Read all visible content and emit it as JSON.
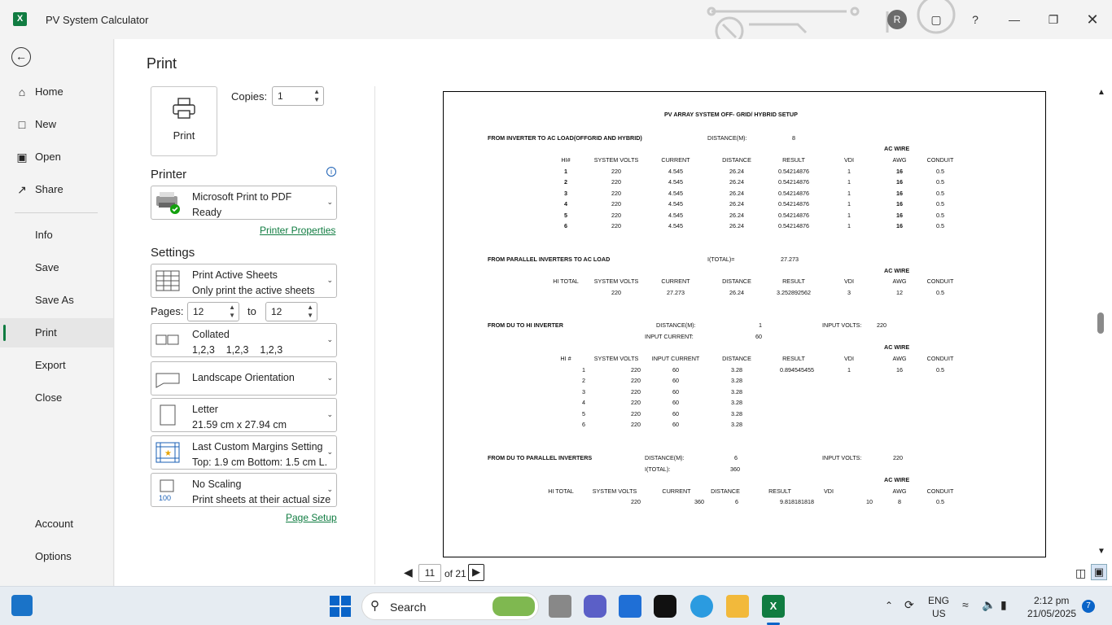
{
  "window": {
    "title": "PV System Calculator",
    "avatar_initial": "R"
  },
  "sidebar": {
    "items": [
      {
        "label": "Home",
        "icon": "home-icon"
      },
      {
        "label": "New",
        "icon": "new-document-icon"
      },
      {
        "label": "Open",
        "icon": "folder-icon"
      },
      {
        "label": "Share",
        "icon": "share-icon"
      },
      {
        "label": "Info"
      },
      {
        "label": "Save"
      },
      {
        "label": "Save As"
      },
      {
        "label": "Print"
      },
      {
        "label": "Export"
      },
      {
        "label": "Close"
      },
      {
        "label": "Account"
      },
      {
        "label": "Options"
      }
    ]
  },
  "print": {
    "title": "Print",
    "print_button": "Print",
    "copies_label": "Copies:",
    "copies_value": "1",
    "printer_heading": "Printer",
    "printer_name": "Microsoft Print to PDF",
    "printer_status": "Ready",
    "printer_properties": "Printer Properties",
    "settings_heading": "Settings",
    "active_sheets": "Print Active Sheets",
    "active_sheets_desc": "Only print the active sheets",
    "pages_label": "Pages:",
    "pages_from": "12",
    "pages_to_label": "to",
    "pages_to": "12",
    "collated": "Collated",
    "collated_desc": "1,2,3    1,2,3    1,2,3",
    "orientation": "Landscape Orientation",
    "paper": "Letter",
    "paper_desc": "21.59 cm x 27.94 cm",
    "margins": "Last Custom Margins Setting",
    "margins_desc": "Top: 1.9 cm Bottom: 1.5 cm L...",
    "scaling": "No Scaling",
    "scaling_desc": "Print sheets at their actual size",
    "scaling_num": "100",
    "page_setup": "Page Setup",
    "current_page": "11",
    "page_of": "of 21"
  },
  "sheet": {
    "title": "PV ARRAY SYSTEM OFF- GRID/ HYBRID SETUP",
    "s1": {
      "heading": "FROM INVERTER TO AC LOAD(OFFGRID AND HYBRID)",
      "dist_label": "DISTANCE(M):",
      "dist_value": "8",
      "acwire": "AC WIRE",
      "headers": [
        "HI#",
        "SYSTEM VOLTS",
        "CURRENT",
        "DISTANCE",
        "RESULT",
        "VDI",
        "AWG",
        "CONDUIT"
      ],
      "rows": [
        [
          "1",
          "220",
          "4.545",
          "26.24",
          "0.54214876",
          "1",
          "16",
          "0.5"
        ],
        [
          "2",
          "220",
          "4.545",
          "26.24",
          "0.54214876",
          "1",
          "16",
          "0.5"
        ],
        [
          "3",
          "220",
          "4.545",
          "26.24",
          "0.54214876",
          "1",
          "16",
          "0.5"
        ],
        [
          "4",
          "220",
          "4.545",
          "26.24",
          "0.54214876",
          "1",
          "16",
          "0.5"
        ],
        [
          "5",
          "220",
          "4.545",
          "26.24",
          "0.54214876",
          "1",
          "16",
          "0.5"
        ],
        [
          "6",
          "220",
          "4.545",
          "26.24",
          "0.54214876",
          "1",
          "16",
          "0.5"
        ]
      ]
    },
    "s2": {
      "heading": "FROM PARALLEL INVERTERS TO AC LOAD",
      "itotal_label": "I(TOTAL)=",
      "itotal_value": "27.273",
      "acwire": "AC WIRE",
      "headers": [
        "HI TOTAL",
        "SYSTEM VOLTS",
        "CURRENT",
        "DISTANCE",
        "RESULT",
        "VDI",
        "AWG",
        "CONDUIT"
      ],
      "row": [
        "220",
        "27.273",
        "26.24",
        "3.252892562",
        "3",
        "12",
        "0.5"
      ]
    },
    "s3": {
      "heading": "FROM DU TO HI INVERTER",
      "dist_label": "DISTANCE(M):",
      "dist_value": "1",
      "input_volts_label": "INPUT VOLTS:",
      "input_volts": "220",
      "input_current_label": "INPUT CURRENT:",
      "input_current": "60",
      "acwire": "AC WIRE",
      "headers": [
        "HI #",
        "SYSTEM VOLTS",
        "INPUT CURRENT",
        "DISTANCE",
        "RESULT",
        "VDI",
        "AWG",
        "CONDUIT"
      ],
      "first_extra": [
        "0.894545455",
        "1",
        "16",
        "0.5"
      ],
      "rows": [
        [
          "1",
          "220",
          "60",
          "3.28"
        ],
        [
          "2",
          "220",
          "60",
          "3.28"
        ],
        [
          "3",
          "220",
          "60",
          "3.28"
        ],
        [
          "4",
          "220",
          "60",
          "3.28"
        ],
        [
          "5",
          "220",
          "60",
          "3.28"
        ],
        [
          "6",
          "220",
          "60",
          "3.28"
        ]
      ]
    },
    "s4": {
      "heading": "FROM DU TO PARALLEL INVERTERS",
      "dist_label": "DISTANCE(M):",
      "dist_value": "6",
      "input_volts_label": "INPUT VOLTS:",
      "input_volts": "220",
      "itotal_label": "I(TOTAL):",
      "itotal_value": "360",
      "acwire": "AC WIRE",
      "headers": [
        "HI TOTAL",
        "SYSTEM VOLTS",
        "CURRENT",
        "DISTANCE",
        "RESULT",
        "VDI",
        "AWG",
        "CONDUIT"
      ],
      "row": [
        "220",
        "360",
        "6",
        "9.818181818",
        "10",
        "8",
        "0.5"
      ]
    }
  },
  "taskbar": {
    "search": "Search",
    "lang1": "ENG",
    "lang2": "US",
    "time": "2:12 pm",
    "date": "21/05/2025",
    "notif": "7"
  }
}
